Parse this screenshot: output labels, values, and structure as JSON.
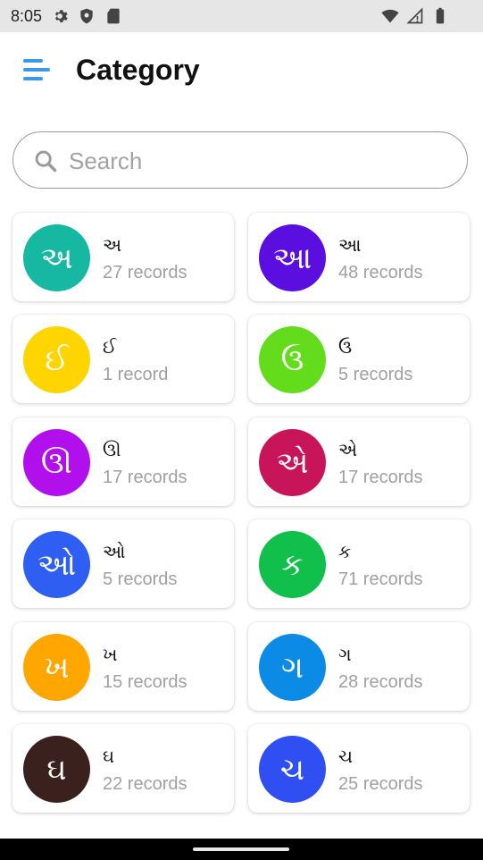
{
  "status_bar": {
    "time": "8:05",
    "left_icons": [
      "gear-icon",
      "shield-icon",
      "sd-card-icon"
    ],
    "right_icons": [
      "wifi-icon",
      "signal-icon",
      "battery-icon"
    ]
  },
  "header": {
    "title": "Category",
    "menu_icon": "menu-icon",
    "accent": "#3a9ae8"
  },
  "search": {
    "placeholder": "Search",
    "value": ""
  },
  "categories": [
    {
      "letter": "અ",
      "label": "અ",
      "count": "27 records",
      "color": "#16b8a1"
    },
    {
      "letter": "આ",
      "label": "આ",
      "count": "48 records",
      "color": "#5a0ee0"
    },
    {
      "letter": "ઈ",
      "label": "ઈ",
      "count": "1 record",
      "color": "#ffd500"
    },
    {
      "letter": "ઉ",
      "label": "ઉ",
      "count": "5 records",
      "color": "#62dc1b"
    },
    {
      "letter": "ઊ",
      "label": "ઊ",
      "count": "17 records",
      "color": "#b10fec"
    },
    {
      "letter": "એ",
      "label": "એ",
      "count": "17 records",
      "color": "#c8155a"
    },
    {
      "letter": "ઓ",
      "label": "ઓ",
      "count": "5 records",
      "color": "#2f5ff2"
    },
    {
      "letter": "ક",
      "label": "ક",
      "count": "71 records",
      "color": "#10c04a"
    },
    {
      "letter": "ખ",
      "label": "ખ",
      "count": "15 records",
      "color": "#ffa600"
    },
    {
      "letter": "ગ",
      "label": "ગ",
      "count": "28 records",
      "color": "#0b8be6"
    },
    {
      "letter": "ઘ",
      "label": "ઘ",
      "count": "22 records",
      "color": "#3a211d"
    },
    {
      "letter": "ચ",
      "label": "ચ",
      "count": "25 records",
      "color": "#2f4ff2"
    }
  ]
}
